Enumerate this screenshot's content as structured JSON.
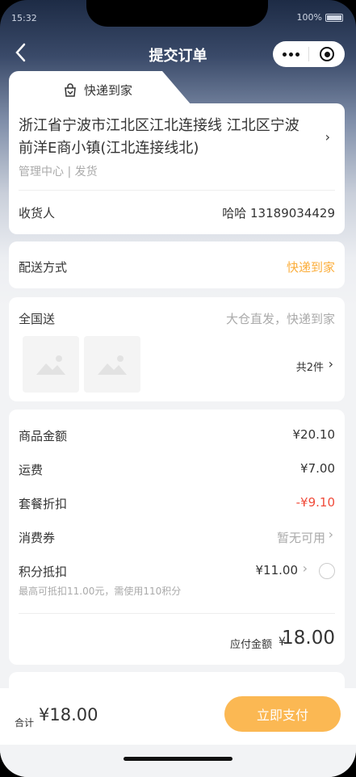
{
  "status": {
    "time": "15:32",
    "battery": "100%"
  },
  "nav": {
    "title": "提交订单"
  },
  "tab": {
    "label": "快递到家"
  },
  "address": {
    "full": "浙江省宁波市江北区江北连接线 江北区宁波前洋E商小镇(江北连接线北)",
    "sub": "管理中心 | 发货",
    "receiver_label": "收货人",
    "receiver": "哈哈 13189034429"
  },
  "delivery": {
    "label": "配送方式",
    "value": "快递到家",
    "value_color": "#fbae3c"
  },
  "group": {
    "name": "全国送",
    "desc": "大仓直发，快递到家",
    "count": "共2件"
  },
  "amounts": {
    "goods_label": "商品金额",
    "goods": "¥20.10",
    "freight_label": "运费",
    "freight": "¥7.00",
    "discount_label": "套餐折扣",
    "discount": "-¥9.10",
    "discount_color": "#f04b3a",
    "coupon_label": "消费券",
    "coupon": "暂无可用",
    "points_label": "积分抵扣",
    "points": "¥11.00",
    "points_note": "最高可抵扣11.00元，需使用110积分",
    "payable_label": "应付金额",
    "payable_symbol": "¥",
    "payable": "18.00"
  },
  "footer": {
    "total_label": "合计",
    "total": "¥18.00",
    "pay_button": "立即支付"
  }
}
